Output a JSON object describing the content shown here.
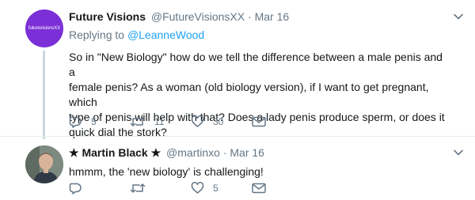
{
  "tweets": [
    {
      "avatar_text": "futurevisionsXX",
      "name": "Future Visions",
      "handle": "@FutureVisionsXX",
      "separator": "·",
      "date": "Mar 16",
      "replying_prefix": "Replying to",
      "replying_mention": "@LeanneWood",
      "text_lines": [
        "So in \"New Biology\" how do we tell the difference between a male penis and a",
        "female penis? As a woman (old biology version), if I want to get pregnant, which",
        "type of penis will help with that? Does a lady penis produce sperm, or does it",
        "quick dial the stork?"
      ],
      "replies": "5",
      "retweets": "11",
      "likes": "30"
    },
    {
      "name": "★ Martin Black ★",
      "handle": "@martinxo",
      "separator": "·",
      "date": "Mar 16",
      "text_lines": [
        "hmmm, the 'new biology' is challenging!"
      ],
      "replies": "",
      "retweets": "",
      "likes": "5"
    }
  ],
  "colors": {
    "accent": "#1da1f2",
    "muted": "#657786",
    "text": "#14171a",
    "thread_line": "#ccd6dd",
    "avatar1_bg": "#7b2fd6"
  },
  "icons": [
    "chevron-down-icon",
    "reply-icon",
    "retweet-icon",
    "like-icon",
    "message-icon"
  ]
}
